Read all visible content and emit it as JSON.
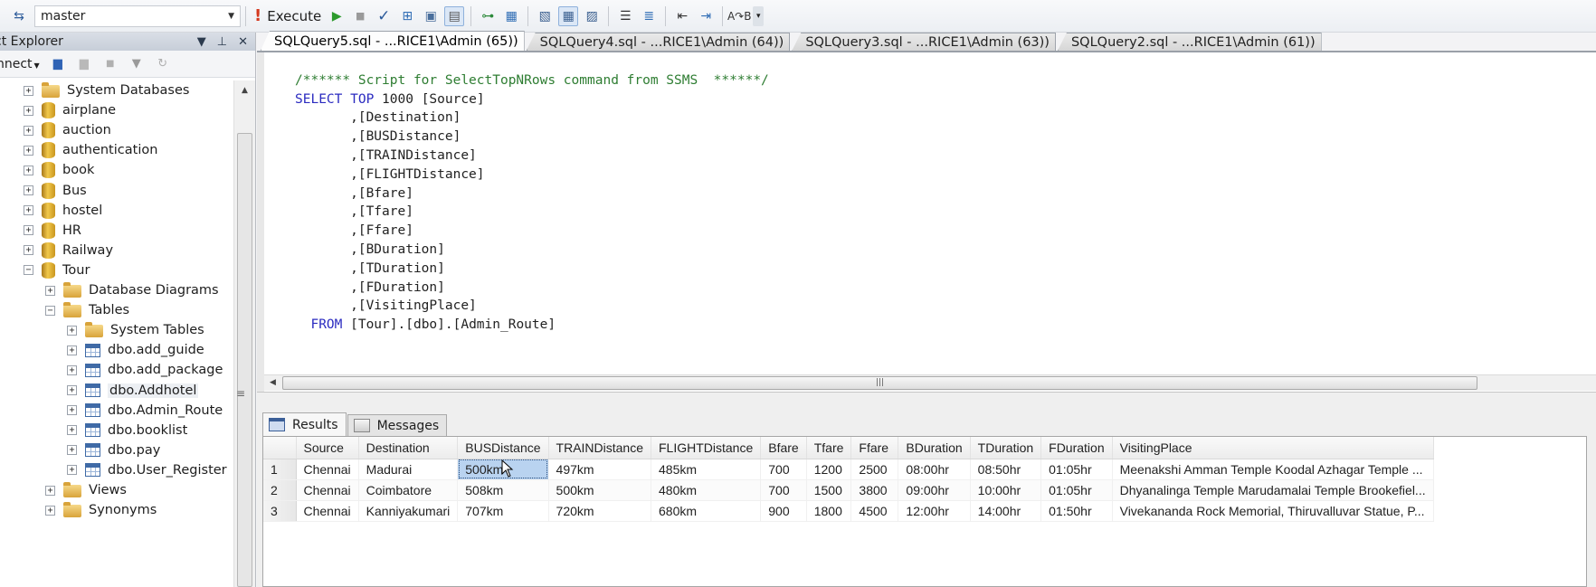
{
  "toolbar": {
    "database": "master",
    "execute_label": "Execute",
    "icons": [
      "change-connection-icon",
      "run-icon",
      "stop-icon",
      "parse-icon",
      "display-plan-icon",
      "query-designer-icon",
      "results-to-text-icon",
      "specify-values-icon",
      "include-plan-icon",
      "results-to-grid-icon",
      "results-to-file-icon",
      "comment-icon",
      "uncomment-icon",
      "decrease-indent-icon",
      "increase-indent-icon",
      "specify-template-icon"
    ]
  },
  "object_explorer": {
    "title": "ct Explorer",
    "connect_label": "nnect",
    "tree": [
      {
        "label": "System Databases",
        "type": "folder",
        "level": 0,
        "expanded": false
      },
      {
        "label": "airplane",
        "type": "db",
        "level": 0,
        "expanded": false
      },
      {
        "label": "auction",
        "type": "db",
        "level": 0,
        "expanded": false
      },
      {
        "label": "authentication",
        "type": "db",
        "level": 0,
        "expanded": false
      },
      {
        "label": "book",
        "type": "db",
        "level": 0,
        "expanded": false
      },
      {
        "label": "Bus",
        "type": "db",
        "level": 0,
        "expanded": false
      },
      {
        "label": "hostel",
        "type": "db",
        "level": 0,
        "expanded": false
      },
      {
        "label": "HR",
        "type": "db",
        "level": 0,
        "expanded": false
      },
      {
        "label": "Railway",
        "type": "db",
        "level": 0,
        "expanded": false
      },
      {
        "label": "Tour",
        "type": "db",
        "level": 0,
        "expanded": true
      },
      {
        "label": "Database Diagrams",
        "type": "folder",
        "level": 1,
        "expanded": false
      },
      {
        "label": "Tables",
        "type": "folder",
        "level": 1,
        "expanded": true
      },
      {
        "label": "System Tables",
        "type": "folder",
        "level": 2,
        "expanded": false
      },
      {
        "label": "dbo.add_guide",
        "type": "table",
        "level": 2,
        "expanded": false
      },
      {
        "label": "dbo.add_package",
        "type": "table",
        "level": 2,
        "expanded": false
      },
      {
        "label": "dbo.Addhotel",
        "type": "table",
        "level": 2,
        "expanded": false,
        "highlighted": true
      },
      {
        "label": "dbo.Admin_Route",
        "type": "table",
        "level": 2,
        "expanded": false
      },
      {
        "label": "dbo.booklist",
        "type": "table",
        "level": 2,
        "expanded": false
      },
      {
        "label": "dbo.pay",
        "type": "table",
        "level": 2,
        "expanded": false
      },
      {
        "label": "dbo.User_Register",
        "type": "table",
        "level": 2,
        "expanded": false
      },
      {
        "label": "Views",
        "type": "folder",
        "level": 1,
        "expanded": false
      },
      {
        "label": "Synonyms",
        "type": "folder",
        "level": 1,
        "expanded": false
      }
    ]
  },
  "doc_tabs": [
    {
      "label": "SQLQuery5.sql - ...RICE1\\Admin (65))",
      "active": true
    },
    {
      "label": "SQLQuery4.sql - ...RICE1\\Admin (64))",
      "active": false
    },
    {
      "label": "SQLQuery3.sql - ...RICE1\\Admin (63))",
      "active": false
    },
    {
      "label": "SQLQuery2.sql - ...RICE1\\Admin (61))",
      "active": false
    }
  ],
  "editor": {
    "comment": "/****** Script for SelectTopNRows command from SSMS  ******/",
    "select_kw": "SELECT",
    "top_kw": "TOP",
    "top_rest": " 1000 [Source]",
    "columns": [
      ",[Destination]",
      ",[BUSDistance]",
      ",[TRAINDistance]",
      ",[FLIGHTDistance]",
      ",[Bfare]",
      ",[Tfare]",
      ",[Ffare]",
      ",[BDuration]",
      ",[TDuration]",
      ",[FDuration]",
      ",[VisitingPlace]"
    ],
    "from_kw": "FROM",
    "from_rest": " [Tour].[dbo].[Admin_Route]"
  },
  "results": {
    "tabs": [
      {
        "label": "Results",
        "active": true
      },
      {
        "label": "Messages",
        "active": false
      }
    ],
    "columns": [
      "Source",
      "Destination",
      "BUSDistance",
      "TRAINDistance",
      "FLIGHTDistance",
      "Bfare",
      "Tfare",
      "Ffare",
      "BDuration",
      "TDuration",
      "FDuration",
      "VisitingPlace"
    ],
    "rows": [
      {
        "n": "1",
        "cells": [
          "Chennai",
          "Madurai",
          "500km",
          "497km",
          "485km",
          "700",
          "1200",
          "2500",
          "08:00hr",
          "08:50hr",
          "01:05hr",
          "Meenakshi Amman Temple  Koodal Azhagar Temple  ..."
        ]
      },
      {
        "n": "2",
        "cells": [
          "Chennai",
          "Coimbatore",
          "508km",
          "500km",
          "480km",
          "700",
          "1500",
          "3800",
          "09:00hr",
          "10:00hr",
          "01:05hr",
          "Dhyanalinga Temple  Marudamalai Temple  Brookefiel..."
        ]
      },
      {
        "n": "3",
        "cells": [
          "Chennai",
          "Kanniyakumari",
          "707km",
          "720km",
          "680km",
          "900",
          "1800",
          "4500",
          "12:00hr",
          "14:00hr",
          "01:50hr",
          "Vivekananda Rock Memorial,  Thiruvalluvar Statue,  P..."
        ]
      }
    ],
    "selected_cell": {
      "row": 1,
      "column": "BUSDistance"
    }
  }
}
